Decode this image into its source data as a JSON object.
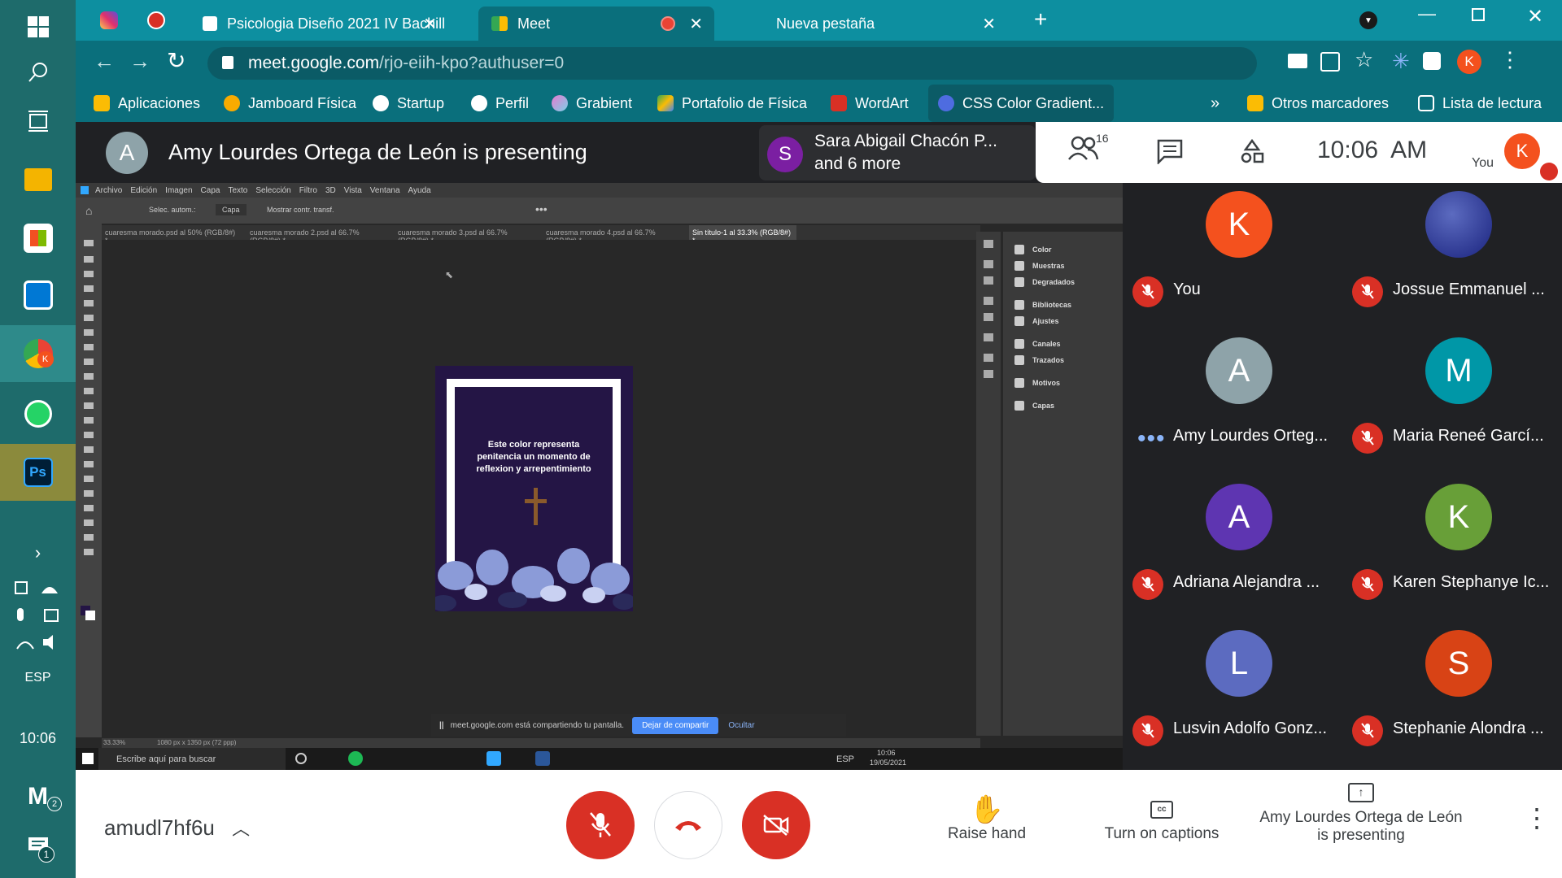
{
  "taskbar": {
    "language": "ESP",
    "time": "10:06",
    "badges": {
      "mail": "2",
      "notifications": "1"
    },
    "ps_label": "Ps"
  },
  "browser": {
    "tabs": [
      {
        "title": "Psicologia Diseño 2021 IV Bachill",
        "active": false
      },
      {
        "title": "Meet",
        "active": true
      },
      {
        "title": "Nueva pestaña",
        "active": false
      }
    ],
    "url_domain": "meet.google.com",
    "url_path": "/rjo-eiih-kpo?authuser=0",
    "profile_initial": "K",
    "bookmarks": [
      {
        "label": "Aplicaciones",
        "color": "#fbbc04"
      },
      {
        "label": "Jamboard Física",
        "color": "#f9ab00"
      },
      {
        "label": "Startup",
        "color": "#ffffff"
      },
      {
        "label": "Perfil",
        "color": "#ffffff"
      },
      {
        "label": "Grabient",
        "color": "#e77bd0"
      },
      {
        "label": "Portafolio de Física",
        "color": "#34a853"
      },
      {
        "label": "WordArt",
        "color": "#d93025"
      },
      {
        "label": "CSS Color Gradient...",
        "color": "#4e6ce0"
      }
    ],
    "more_bookmarks_glyph": "»",
    "other_bookmarks": "Otros marcadores",
    "reading_list": "Lista de lectura"
  },
  "meet": {
    "presenter_initial": "A",
    "presenting_title": "Amy Lourdes Ortega de León is presenting",
    "speaker_initial": "S",
    "speaker_name": "Sara Abigail Chacón P...",
    "speaker_more": "and 6 more",
    "people_count": "16",
    "clock": "10:06  AM",
    "you_label": "You",
    "you_initial": "K",
    "meeting_code": "amudl7hf6u",
    "raise_hand": "Raise hand",
    "captions": "Turn on captions",
    "presenting_line1": "Amy Lourdes Ortega de León",
    "presenting_line2": "is presenting"
  },
  "participants": [
    {
      "initial": "K",
      "name": "You",
      "color": "#f4511e",
      "muted": true
    },
    {
      "initial": "",
      "name": "Jossue Emmanuel ...",
      "color": "#3949ab",
      "muted": true
    },
    {
      "initial": "A",
      "name": "Amy Lourdes Orteg...",
      "color": "#8ea3a9",
      "muted": false
    },
    {
      "initial": "M",
      "name": "Maria Reneé Garcí...",
      "color": "#0097a7",
      "muted": true
    },
    {
      "initial": "A",
      "name": "Adriana Alejandra ...",
      "color": "#5e35b1",
      "muted": true
    },
    {
      "initial": "K",
      "name": "Karen Stephanye Ic...",
      "color": "#689f38",
      "muted": true
    },
    {
      "initial": "L",
      "name": "Lusvin Adolfo Gonz...",
      "color": "#5c6bc0",
      "muted": true
    },
    {
      "initial": "S",
      "name": "Stephanie Alondra ...",
      "color": "#d84315",
      "muted": true
    }
  ],
  "photoshop": {
    "menu": [
      "Archivo",
      "Edición",
      "Imagen",
      "Capa",
      "Texto",
      "Selección",
      "Filtro",
      "3D",
      "Vista",
      "Ventana",
      "Ayuda"
    ],
    "options": {
      "auto_select": "Selec. autom.:",
      "layer": "Capa",
      "transform": "Mostrar contr. transf."
    },
    "doc_tabs": [
      "cuaresma morado.psd al 50% (RGB/8#) *",
      "cuaresma morado 2.psd al 66.7% (RGB/8#) *",
      "cuaresma morado 3.psd al 66.7% (RGB/8#) *",
      "cuaresma morado 4.psd al 66.7% (RGB/8#) *",
      "Sin título-1 al 33.3% (RGB/8#) *"
    ],
    "panels": [
      "Color",
      "Muestras",
      "Degradados",
      "Bibliotecas",
      "Ajustes",
      "Canales",
      "Trazados",
      "Motivos",
      "Capas"
    ],
    "artwork_text": "Este color representa penitencia un momento de reflexion y arrepentimiento",
    "share_notice": "meet.google.com está compartiendo tu pantalla.",
    "stop_sharing": "Dejar de compartir",
    "hide": "Ocultar",
    "zoom": "33.33%",
    "doc_size": "1080 px x 1350 px (72 ppp)",
    "win_search": "Escribe aquí para buscar",
    "win_lang": "ESP",
    "win_time": "10:06",
    "win_date": "19/05/2021"
  }
}
